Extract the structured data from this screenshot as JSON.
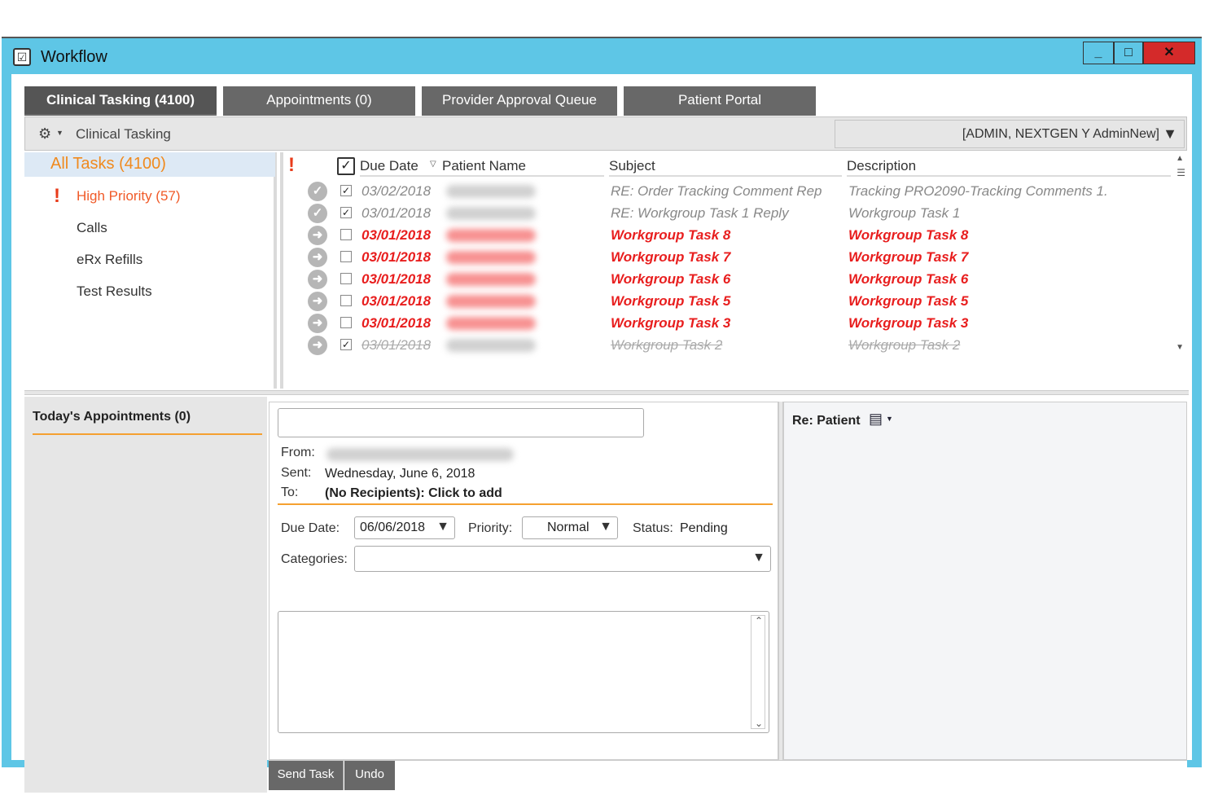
{
  "window": {
    "title": "Workflow",
    "minimize": "_",
    "maximize": "□",
    "close": "✕"
  },
  "tabs": [
    {
      "label": "Clinical Tasking (4100)",
      "active": true
    },
    {
      "label": "Appointments (0)",
      "active": false
    },
    {
      "label": "Provider Approval Queue",
      "active": false
    },
    {
      "label": "Patient Portal",
      "active": false
    }
  ],
  "toolbar": {
    "title": "Clinical Tasking",
    "user_filter": "[ADMIN, NEXTGEN Y AdminNew]"
  },
  "nav": {
    "all_tasks": "All Tasks (4100)",
    "high_priority": "High Priority (57)",
    "calls": "Calls",
    "erx_refills": "eRx Refills",
    "test_results": "Test Results"
  },
  "grid": {
    "columns": {
      "due_date": "Due Date",
      "patient_name": "Patient Name",
      "subject": "Subject",
      "description": "Description"
    },
    "rows": [
      {
        "state": "done",
        "checked": true,
        "due": "03/02/2018",
        "subject": "RE: Order Tracking Comment Rep",
        "description": "Tracking PRO2090-Tracking Comments 1."
      },
      {
        "state": "done",
        "checked": true,
        "due": "03/01/2018",
        "subject": "RE: Workgroup Task 1 Reply",
        "description": "Workgroup Task 1"
      },
      {
        "state": "open",
        "checked": false,
        "due": "03/01/2018",
        "subject": " Workgroup Task 8",
        "description": " Workgroup Task 8"
      },
      {
        "state": "open",
        "checked": false,
        "due": "03/01/2018",
        "subject": " Workgroup Task 7",
        "description": " Workgroup Task 7"
      },
      {
        "state": "open",
        "checked": false,
        "due": "03/01/2018",
        "subject": " Workgroup Task 6",
        "description": " Workgroup Task 6"
      },
      {
        "state": "open",
        "checked": false,
        "due": "03/01/2018",
        "subject": "Workgroup Task 5",
        "description": "Workgroup Task 5"
      },
      {
        "state": "open",
        "checked": false,
        "due": "03/01/2018",
        "subject": "Workgroup Task 3",
        "description": "Workgroup Task 3"
      },
      {
        "state": "struck",
        "checked": true,
        "due": "03/01/2018",
        "subject": "Workgroup Task 2",
        "description": "Workgroup Task 2"
      }
    ]
  },
  "appointments": {
    "title": "Today's Appointments (0)"
  },
  "compose": {
    "subject_value": "",
    "from_label": "From:",
    "sent_label": "Sent:",
    "sent_value": "Wednesday, June 6, 2018",
    "to_label": "To:",
    "to_value": "(No Recipients): Click to add",
    "due_date_label": "Due Date:",
    "due_date_value": "06/06/2018",
    "priority_label": "Priority:",
    "priority_value": "Normal",
    "status_label": "Status:",
    "status_value": "Pending",
    "categories_label": "Categories:",
    "categories_value": "",
    "notes_value": ""
  },
  "patient_panel": {
    "title": "Re: Patient"
  },
  "actions": {
    "send": "Send Task",
    "undo": "Undo"
  },
  "colors": {
    "window_frame": "#5ec6e6",
    "tab_bg": "#686868",
    "accent_orange": "#f5a030",
    "open_task_red": "#e81e1e",
    "all_tasks_orange": "#f08a1e"
  }
}
